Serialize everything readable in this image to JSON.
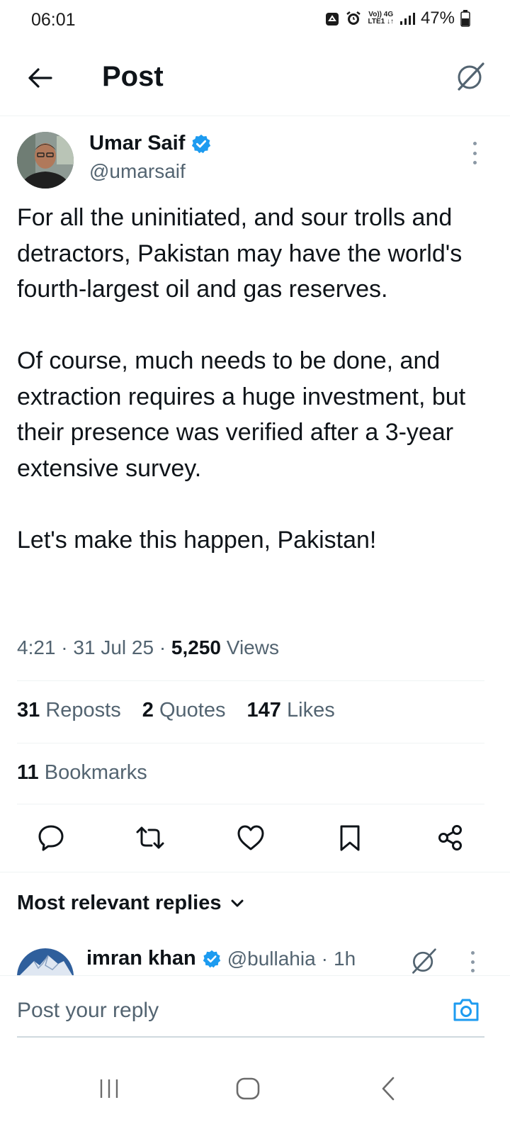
{
  "status_bar": {
    "time": "06:01",
    "network_top": "Vo)) 4G",
    "network_bottom": "LTE1 ↓↑",
    "battery": "47%"
  },
  "header": {
    "title": "Post"
  },
  "post": {
    "author": {
      "name": "Umar Saif",
      "handle": "@umarsaif",
      "verified": true
    },
    "paragraphs": [
      "For all the uninitiated, and sour trolls and detractors, Pakistan may have the world's fourth-largest oil and gas reserves.",
      "Of course, much needs to be done, and extraction requires a huge investment, but their presence was verified after a 3-year extensive survey.",
      "Let's make this happen, Pakistan!"
    ],
    "time": "4:21",
    "date": "31 Jul 25",
    "sep": "·",
    "views_count": "5,250",
    "views_label": "Views",
    "stats": {
      "reposts_count": "31",
      "reposts_label": "Reposts",
      "quotes_count": "2",
      "quotes_label": "Quotes",
      "likes_count": "147",
      "likes_label": "Likes",
      "bookmarks_count": "11",
      "bookmarks_label": "Bookmarks"
    }
  },
  "actions": [
    "reply-icon",
    "repost-icon",
    "like-icon",
    "bookmark-icon",
    "share-icon"
  ],
  "replies": {
    "header": "Most relevant replies",
    "first": {
      "name": "imran khan",
      "handle": "@bullahia",
      "sep": "·",
      "age": "1h",
      "verified": true
    }
  },
  "composer": {
    "placeholder": "Post your reply"
  },
  "colors": {
    "accent": "#1d9bf0",
    "text_primary": "#0f1419",
    "text_secondary": "#536471",
    "divider": "#eff3f4"
  }
}
